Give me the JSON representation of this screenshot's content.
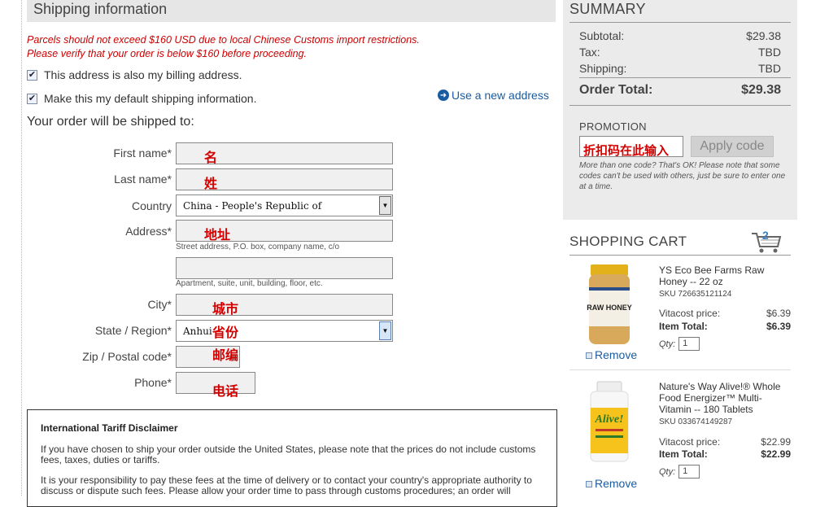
{
  "shipping": {
    "title": "Shipping information",
    "warning_line1": "Parcels should not exceed $160 USD due to local Chinese Customs import restrictions.",
    "warning_line2": "Please verify that your order is below $160 before proceeding.",
    "billing_checkbox": "This address is also my billing address.",
    "default_checkbox": "Make this my default shipping information.",
    "use_new_address": "Use a new address",
    "shipped_to": "Your order will be shipped to:",
    "fields": {
      "first_name": {
        "label": "First name*",
        "value": "名"
      },
      "last_name": {
        "label": "Last name*",
        "value": "姓"
      },
      "country": {
        "label": "Country",
        "value": "China - People's Republic of"
      },
      "address": {
        "label": "Address*",
        "value": "地址",
        "hint": "Street address, P.O. box, company name, c/o"
      },
      "address2": {
        "hint": "Apartment, suite, unit, building, floor, etc."
      },
      "city": {
        "label": "City*",
        "value": "城市"
      },
      "state": {
        "label": "State / Region*",
        "value": "Anhui",
        "overlay": "省份"
      },
      "zip": {
        "label": "Zip / Postal code*",
        "value": "邮编"
      },
      "phone": {
        "label": "Phone*",
        "value": "电话"
      }
    }
  },
  "tariff": {
    "title": "International Tariff Disclaimer",
    "para1": "If you have chosen to ship your order outside the United States, please note that the prices do not include customs fees, taxes, duties or tariffs.",
    "para2": "It is your responsibility to pay these fees at the time of delivery or to contact your country's appropriate authority to discuss or dispute such fees. Please allow your order time to pass through customs procedures; an order will"
  },
  "summary": {
    "title": "SUMMARY",
    "subtotal_label": "Subtotal:",
    "subtotal": "$29.38",
    "tax_label": "Tax:",
    "tax": "TBD",
    "shipping_label": "Shipping:",
    "shipping": "TBD",
    "total_label": "Order Total:",
    "total": "$29.38",
    "promo_label": "PROMOTION",
    "promo_value": "折扣码在此输入",
    "apply": "Apply code",
    "promo_note": "More than one code? That's OK! Please note that some codes can't be used with others, just be sure to enter one at a time."
  },
  "cart": {
    "title": "SHOPPING CART",
    "count": "2",
    "items": [
      {
        "name": "YS Eco Bee Farms Raw Honey -- 22 oz",
        "sku": "SKU 726635121124",
        "price_label": "Vitacost price:",
        "price": "$6.39",
        "total_label": "Item Total:",
        "total": "$6.39",
        "qty_label": "Qty:",
        "qty": "1",
        "image_label": "RAW HONEY",
        "remove": "Remove"
      },
      {
        "name": "Nature's Way Alive!® Whole Food Energizer™ Multi-Vitamin -- 180 Tablets",
        "sku": "SKU 033674149287",
        "price_label": "Vitacost price:",
        "price": "$22.99",
        "total_label": "Item Total:",
        "total": "$22.99",
        "qty_label": "Qty:",
        "qty": "1",
        "image_label": "Alive!",
        "remove": "Remove"
      }
    ]
  },
  "colors": {
    "warning": "#cc0000",
    "link": "#1a5ca0",
    "panel": "#ebebeb",
    "annotation": "#d40000"
  }
}
